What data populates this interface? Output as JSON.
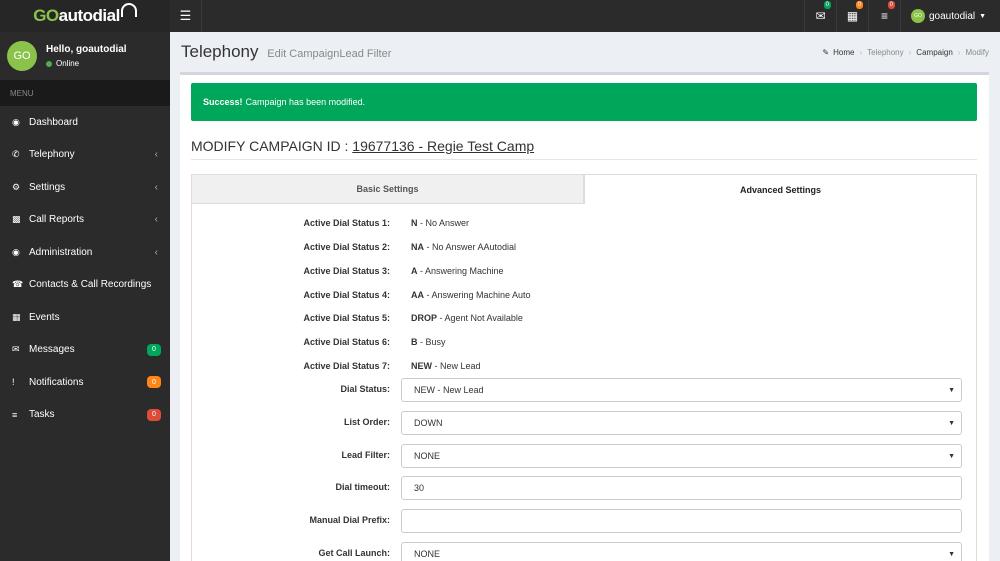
{
  "brand": {
    "go": "GO",
    "autodial": "autodial"
  },
  "topbar": {
    "badges": {
      "messages": "0",
      "calendar": "0",
      "tasks": "0"
    },
    "username": "goautodial",
    "avatar_initials": "GO"
  },
  "sidebar": {
    "avatar_initials": "GO",
    "greeting": "Hello, goautodial",
    "status": "Online",
    "menu_header": "MENU",
    "items": [
      {
        "label": "Dashboard"
      },
      {
        "label": "Telephony"
      },
      {
        "label": "Settings"
      },
      {
        "label": "Call Reports"
      },
      {
        "label": "Administration"
      },
      {
        "label": "Contacts & Call Recordings"
      },
      {
        "label": "Events"
      },
      {
        "label": "Messages",
        "badge": "0"
      },
      {
        "label": "Notifications",
        "badge": "0"
      },
      {
        "label": "Tasks",
        "badge": "0"
      }
    ]
  },
  "header": {
    "title": "Telephony",
    "subtitle": "Edit CampaignLead Filter",
    "breadcrumb": [
      "Home",
      "Telephony",
      "Campaign",
      "Modify"
    ]
  },
  "alert": {
    "strong": "Success!",
    "text": "Campaign has been modified."
  },
  "campaign": {
    "prefix": "MODIFY CAMPAIGN ID : ",
    "id": "19677136 - Regie Test Camp"
  },
  "tabs": [
    {
      "label": "Basic Settings"
    },
    {
      "label": "Advanced Settings"
    }
  ],
  "statuses": [
    {
      "label": "Active Dial Status 1:",
      "code": "N",
      "desc": " - No Answer"
    },
    {
      "label": "Active Dial Status 2:",
      "code": "NA",
      "desc": " - No Answer AAutodial"
    },
    {
      "label": "Active Dial Status 3:",
      "code": "A",
      "desc": " - Answering Machine"
    },
    {
      "label": "Active Dial Status 4:",
      "code": "AA",
      "desc": " - Answering Machine Auto"
    },
    {
      "label": "Active Dial Status 5:",
      "code": "DROP",
      "desc": " - Agent Not Available"
    },
    {
      "label": "Active Dial Status 6:",
      "code": "B",
      "desc": " - Busy"
    },
    {
      "label": "Active Dial Status 7:",
      "code": "NEW",
      "desc": " - New Lead"
    }
  ],
  "fields": [
    {
      "label": "Dial Status:",
      "value": "NEW - New Lead"
    },
    {
      "label": "List Order:",
      "value": "DOWN"
    },
    {
      "label": "Lead Filter:",
      "value": "NONE"
    },
    {
      "label": "Dial timeout:",
      "value": "30"
    },
    {
      "label": "Manual Dial Prefix:",
      "value": ""
    },
    {
      "label": "Get Call Launch:",
      "value": "NONE"
    }
  ],
  "colors": {
    "success": "#00a65a",
    "brand_green": "#8bc34a",
    "badge_green": "#00a65a",
    "badge_orange": "#ff851b",
    "badge_red": "#dd4b39"
  }
}
